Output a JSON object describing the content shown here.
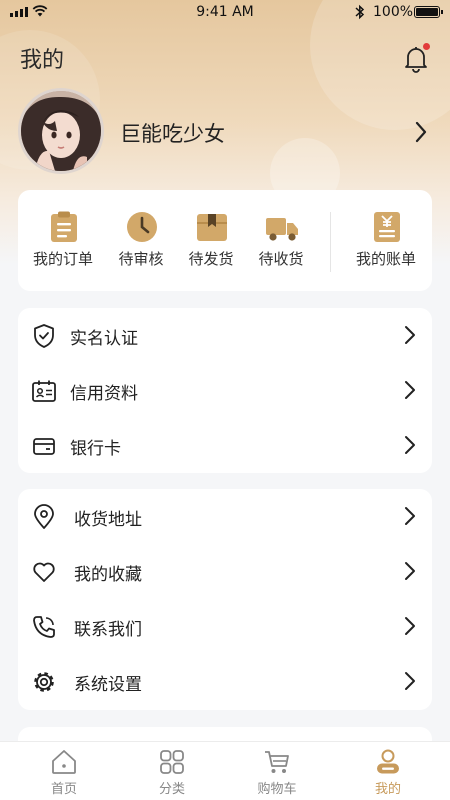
{
  "status_bar": {
    "time": "9:41 AM",
    "battery": "100%"
  },
  "header": {
    "title": "我的"
  },
  "profile": {
    "username": "巨能吃少女"
  },
  "orders": [
    {
      "label": "我的订单",
      "icon": "clipboard-icon"
    },
    {
      "label": "待审核",
      "icon": "clock-icon"
    },
    {
      "label": "待发货",
      "icon": "package-icon"
    },
    {
      "label": "待收货",
      "icon": "truck-icon"
    },
    {
      "label": "我的账单",
      "icon": "bill-icon"
    }
  ],
  "section1": [
    {
      "label": "实名认证",
      "icon": "shield-check-icon"
    },
    {
      "label": "信用资料",
      "icon": "id-card-icon"
    },
    {
      "label": "银行卡",
      "icon": "card-icon"
    }
  ],
  "section2": [
    {
      "label": "收货地址",
      "icon": "location-icon"
    },
    {
      "label": "我的收藏",
      "icon": "heart-icon"
    },
    {
      "label": "联系我们",
      "icon": "phone-icon"
    },
    {
      "label": "系统设置",
      "icon": "settings-icon"
    }
  ],
  "tabbar": [
    {
      "label": "首页",
      "icon": "home-icon"
    },
    {
      "label": "分类",
      "icon": "category-icon"
    },
    {
      "label": "购物车",
      "icon": "cart-icon"
    },
    {
      "label": "我的",
      "icon": "user-icon",
      "active": true
    }
  ],
  "colors": {
    "accent": "#c79a5b",
    "icon_gold": "#d2a869",
    "badge": "#e23b3b"
  }
}
